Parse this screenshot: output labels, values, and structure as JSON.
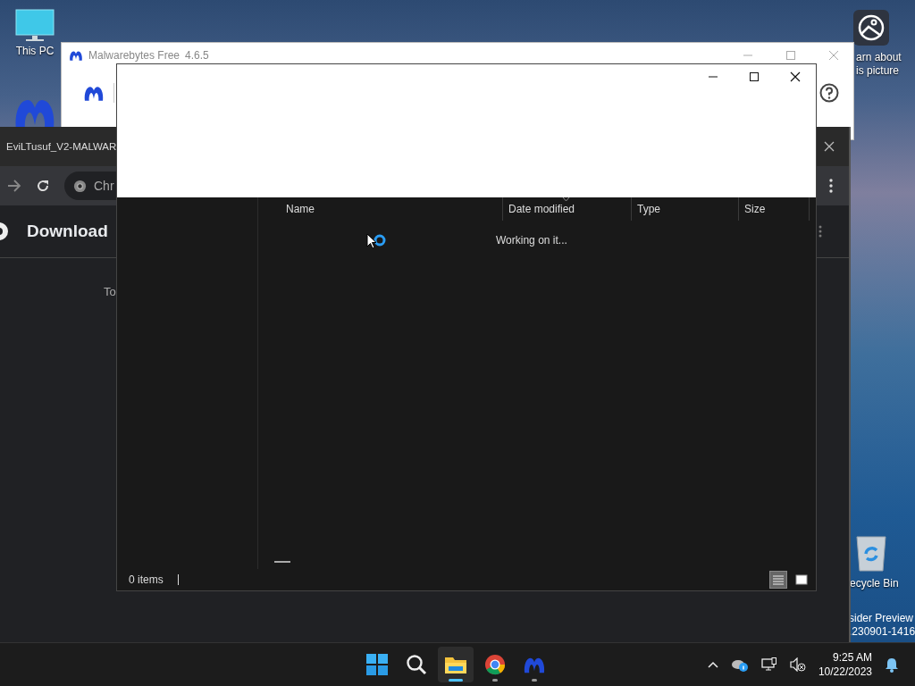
{
  "desktop_icons": [
    {
      "kind": "pc",
      "label_lines": [
        "This PC"
      ]
    },
    {
      "kind": "malwarebytes"
    },
    {
      "kind": "spotlight",
      "label_lines": [
        "arn about",
        "is picture"
      ]
    },
    {
      "kind": "recycle",
      "label_lines": [
        "ecycle Bin"
      ]
    }
  ],
  "watermark_lines": [
    "sider Preview",
    ".230901-1416"
  ],
  "malwarebytes_window": {
    "title": "Malwarebytes Free",
    "version": "4.6.5"
  },
  "browser_window": {
    "tab_title": "EviLTusuf_V2-MALWAR",
    "address": "Chr",
    "page_heading": "Download",
    "page_text": "To"
  },
  "explorer_window": {
    "columns": [
      "Name",
      "Date modified",
      "Type",
      "Size"
    ],
    "loading_text": "Working on it...",
    "status": "0 items",
    "views": [
      {
        "kind": "details",
        "selected": true
      },
      {
        "kind": "tiles",
        "selected": false
      }
    ]
  },
  "taskbar": {
    "apps": [
      {
        "kind": "start",
        "active": false,
        "running": false
      },
      {
        "kind": "search",
        "active": false,
        "running": false
      },
      {
        "kind": "explorer",
        "active": true,
        "running": true
      },
      {
        "kind": "chrome",
        "active": false,
        "running": true
      },
      {
        "kind": "malwarebytes",
        "active": false,
        "running": true
      }
    ],
    "time": "9:25 AM",
    "date": "10/22/2023"
  }
}
